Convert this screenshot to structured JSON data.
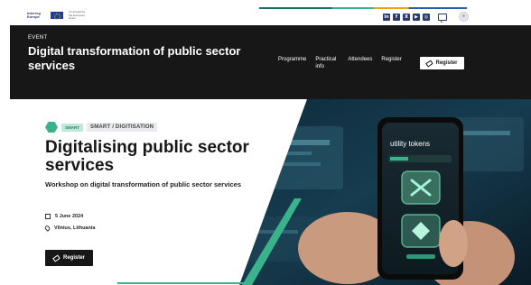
{
  "utility_bar": {
    "brand_name": "Interreg Europe",
    "eu_text": "Co-funded by the European Union",
    "social": [
      {
        "icon": "linkedin-icon",
        "glyph": "in"
      },
      {
        "icon": "facebook-icon",
        "glyph": "f"
      },
      {
        "icon": "x-icon",
        "glyph": "X"
      },
      {
        "icon": "youtube-icon",
        "glyph": "▶"
      },
      {
        "icon": "instagram-icon",
        "glyph": "◎"
      }
    ]
  },
  "event_header": {
    "label": "EVENT",
    "title": "Digital transformation of public sector services",
    "nav": [
      "Programme",
      "Practical info",
      "Attendees",
      "Register"
    ],
    "register_button": "Register"
  },
  "hero": {
    "smart_pill": "SMART",
    "topic": "SMART / DIGITISATION",
    "title": "Digitalising public sector services",
    "subtitle": "Workshop on digital transformation of public sector services",
    "date": "5 June 2024",
    "location": "Vilnius, Lithuania",
    "register_button": "Register",
    "image_text": "utility tokens"
  },
  "colors": {
    "dark": "#171717",
    "accent_green": "#3ab38d",
    "social_navy": "#2a3b6b"
  }
}
